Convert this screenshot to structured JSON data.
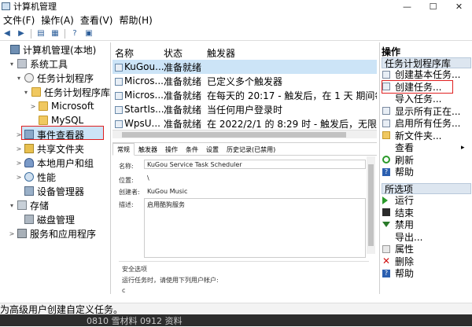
{
  "window": {
    "title": "计算机管理",
    "controls": [
      "—",
      "☐",
      "✕"
    ]
  },
  "menu": [
    "文件(F)",
    "操作(A)",
    "查看(V)",
    "帮助(H)"
  ],
  "tree": {
    "items": [
      {
        "label": "计算机管理(本地)",
        "icon": "computer-icon",
        "expander": "",
        "indent": 0
      },
      {
        "label": "系统工具",
        "icon": "tools-icon",
        "expander": "▾",
        "indent": 1
      },
      {
        "label": "任务计划程序",
        "icon": "clock-icon",
        "expander": "▾",
        "indent": 2
      },
      {
        "label": "任务计划程序库",
        "icon": "folder-icon",
        "expander": "▾",
        "indent": 3,
        "selected": true
      },
      {
        "label": "Microsoft",
        "icon": "folder-icon",
        "expander": ">",
        "indent": 4
      },
      {
        "label": "MySQL",
        "icon": "folder-icon",
        "expander": "",
        "indent": 4
      },
      {
        "label": "事件查看器",
        "icon": "event-viewer-icon",
        "expander": ">",
        "indent": 2
      },
      {
        "label": "共享文件夹",
        "icon": "shared-folder-icon",
        "expander": ">",
        "indent": 2
      },
      {
        "label": "本地用户和组",
        "icon": "users-icon",
        "expander": ">",
        "indent": 2
      },
      {
        "label": "性能",
        "icon": "performance-icon",
        "expander": ">",
        "indent": 2
      },
      {
        "label": "设备管理器",
        "icon": "device-manager-icon",
        "expander": "",
        "indent": 2
      },
      {
        "label": "存储",
        "icon": "storage-icon",
        "expander": "▾",
        "indent": 1
      },
      {
        "label": "磁盘管理",
        "icon": "disk-icon",
        "expander": "",
        "indent": 2
      },
      {
        "label": "服务和应用程序",
        "icon": "services-icon",
        "expander": ">",
        "indent": 1
      }
    ]
  },
  "tasks": {
    "columns": [
      "名称",
      "状态",
      "触发器"
    ],
    "rows": [
      {
        "name": "KuGou...",
        "status": "准备就绪",
        "trigger": "",
        "selected": true
      },
      {
        "name": "Micros...",
        "status": "准备就绪",
        "trigger": "已定义多个触发器"
      },
      {
        "name": "Micros...",
        "status": "准备就绪",
        "trigger": "在每天的 20:17 - 触发后，在 1 天 期间每"
      },
      {
        "name": "StartIs...",
        "status": "准备就绪",
        "trigger": "当任何用户登录时"
      },
      {
        "name": "WpsU...",
        "status": "准备就绪",
        "trigger": "在 2022/2/1 的 8:29 时 - 触发后，无限期"
      }
    ]
  },
  "properties": {
    "tabs": [
      "常规",
      "触发器",
      "操作",
      "条件",
      "设置",
      "历史记录(已禁用)"
    ],
    "name_label": "名称:",
    "name_value": "KuGou Service Task Scheduler",
    "location_label": "位置:",
    "location_value": "\\",
    "author_label": "创建者:",
    "author_value": "KuGou Music",
    "desc_label": "描述:",
    "desc_value": "启用酷狗服务",
    "security_label": "安全选项",
    "run_as_label": "运行任务时，请使用下列用户帐户:",
    "run_as_value": "c"
  },
  "actions": {
    "header": "操作",
    "section1": "任务计划程序库",
    "items1": [
      {
        "label": "创建基本任务...",
        "icon": "doc"
      },
      {
        "label": "创建任务...",
        "icon": "doc"
      },
      {
        "label": "导入任务...",
        "icon": "none"
      },
      {
        "label": "显示所有正在...",
        "icon": "doc"
      },
      {
        "label": "启用所有任务...",
        "icon": "doc"
      },
      {
        "label": "新文件夹...",
        "icon": "fold"
      },
      {
        "label": "查看",
        "icon": "none",
        "arrow": "▸"
      },
      {
        "label": "刷新",
        "icon": "refresh"
      },
      {
        "label": "帮助",
        "icon": "help"
      }
    ],
    "section2": "所选项",
    "items2": [
      {
        "label": "运行",
        "icon": "green"
      },
      {
        "label": "结束",
        "icon": "stop"
      },
      {
        "label": "禁用",
        "icon": "down"
      },
      {
        "label": "导出...",
        "icon": "none"
      },
      {
        "label": "属性",
        "icon": "prop"
      },
      {
        "label": "删除",
        "icon": "red"
      },
      {
        "label": "帮助",
        "icon": "help"
      }
    ]
  },
  "status_text": "为高级用户创建自定义任务。",
  "taskbar_text": "0810 雪材料 0912 资料"
}
